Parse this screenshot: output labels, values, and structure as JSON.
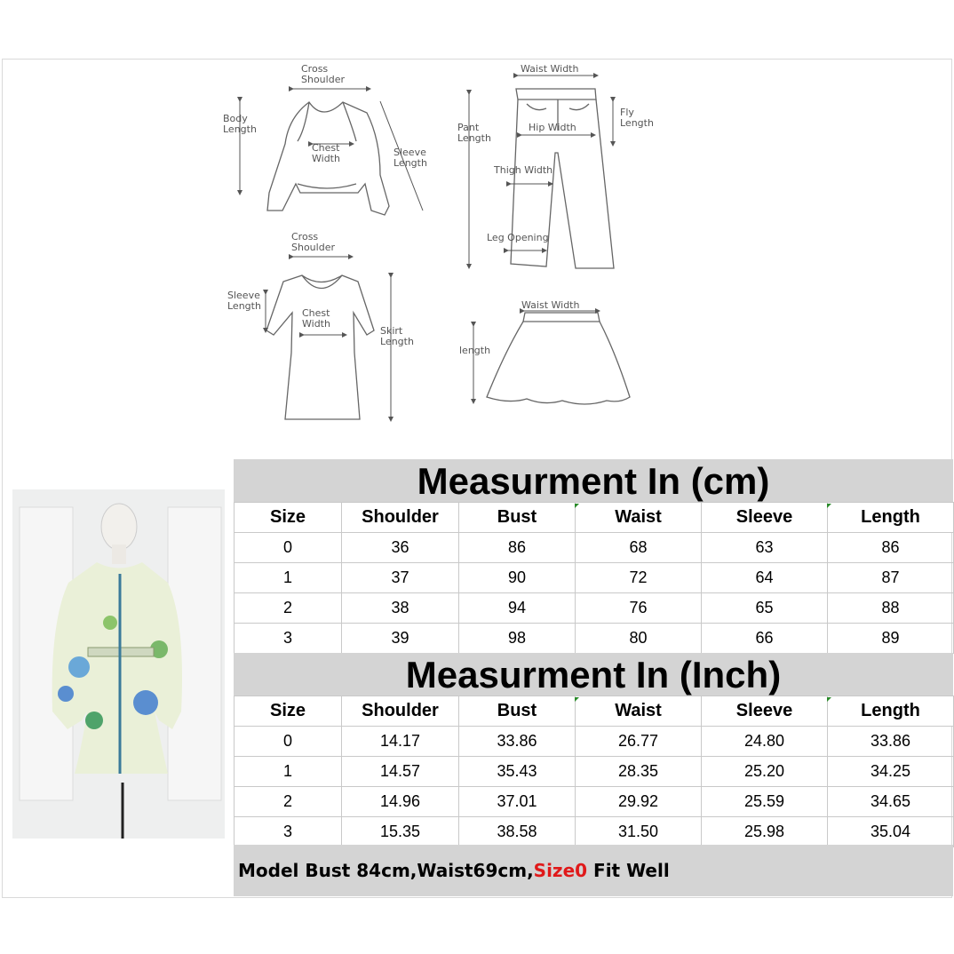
{
  "diagram_labels": {
    "top_cross_shoulder": [
      "Cross",
      "Shoulder"
    ],
    "body_length": [
      "Body",
      "Length"
    ],
    "top_chest_width": [
      "Chest",
      "Width"
    ],
    "top_sleeve_length": [
      "Sleeve",
      "Length"
    ],
    "pant_waist_width": "Waist Width",
    "pant_length": [
      "Pant",
      "Length"
    ],
    "fly_length": [
      "Fly",
      "Length"
    ],
    "hip_width": "Hip Width",
    "thigh_width": "Thigh Width",
    "leg_opening": "Leg Opening",
    "dress_cross_shoulder": [
      "Cross",
      "Shoulder"
    ],
    "dress_sleeve_length": [
      "Sleeve",
      "Length"
    ],
    "dress_chest_width": [
      "Chest",
      "Width"
    ],
    "skirt_length": [
      "Skirt",
      "Length"
    ],
    "skirt_waist_width": "Waist Width",
    "skirt_length_label": "length"
  },
  "cm_section": {
    "title": "Measurment In (cm)",
    "headers": [
      "Size",
      "Shoulder",
      "Bust",
      "Waist",
      "Sleeve",
      "Length"
    ],
    "rows": [
      [
        "0",
        "36",
        "86",
        "68",
        "63",
        "86"
      ],
      [
        "1",
        "37",
        "90",
        "72",
        "64",
        "87"
      ],
      [
        "2",
        "38",
        "94",
        "76",
        "65",
        "88"
      ],
      [
        "3",
        "39",
        "98",
        "80",
        "66",
        "89"
      ]
    ]
  },
  "inch_section": {
    "title": "Measurment In (Inch)",
    "headers": [
      "Size",
      "Shoulder",
      "Bust",
      "Waist",
      "Sleeve",
      "Length"
    ],
    "rows": [
      [
        "0",
        "14.17",
        "33.86",
        "26.77",
        "24.80",
        "33.86"
      ],
      [
        "1",
        "14.57",
        "35.43",
        "28.35",
        "25.20",
        "34.25"
      ],
      [
        "2",
        "14.96",
        "37.01",
        "29.92",
        "25.59",
        "34.65"
      ],
      [
        "3",
        "15.35",
        "38.58",
        "31.50",
        "25.98",
        "35.04"
      ]
    ]
  },
  "footer": {
    "part1": "Model Bust 84cm,Waist69cm,",
    "part2": "Size0",
    "part3": " Fit Well",
    "highlight_color": "#e0191a"
  },
  "colors": {
    "title_band": "#d4d4d4",
    "grid_line": "#c9c9c9",
    "photo_bg": "#eeefef"
  }
}
